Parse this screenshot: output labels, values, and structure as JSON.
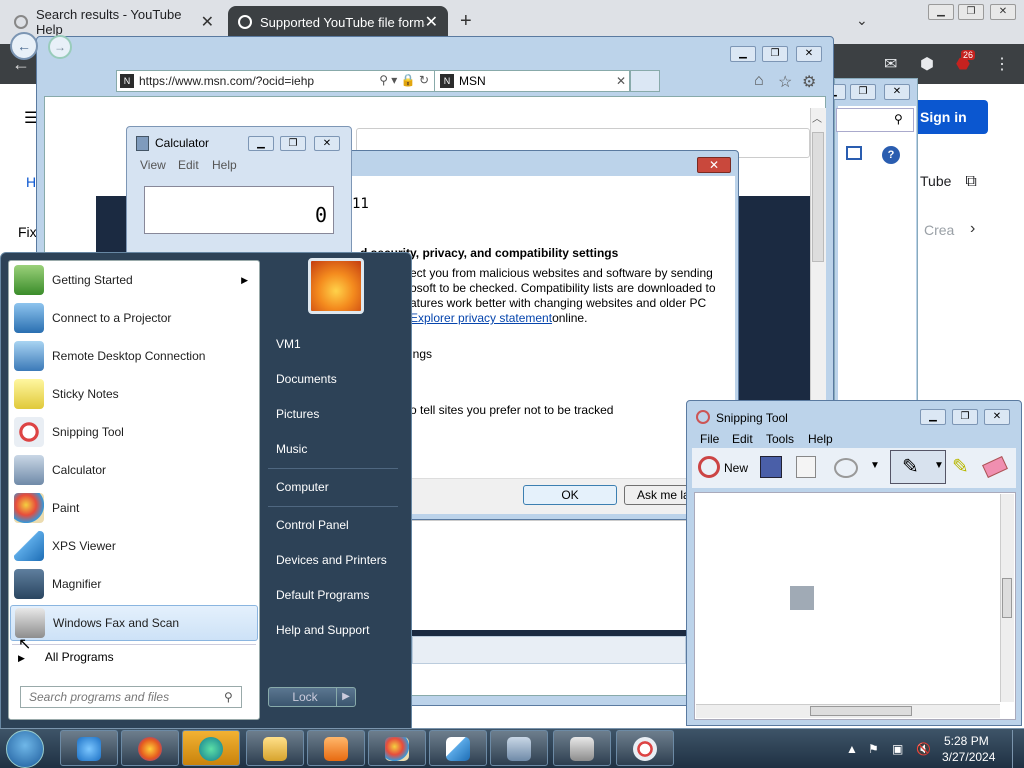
{
  "chrome": {
    "tabs": [
      {
        "title": "Search results - YouTube Help",
        "close": "✕"
      },
      {
        "title": "Supported YouTube file format",
        "close": "✕"
      }
    ],
    "new_tab": "+",
    "tab_menu": "⌄",
    "back": "←",
    "signin": "Sign in",
    "tube_text": "Tube",
    "crea_text": "Crea",
    "fix_text": "Fix",
    "h_text": "H",
    "ext_badge": "26",
    "toolbar_icons": [
      "✉",
      "⬢",
      "⋮"
    ]
  },
  "ie": {
    "address": "https://www.msn.com/?ocid=iehp",
    "address_icon": "N",
    "tab_title": "MSN",
    "tab_close": "✕"
  },
  "dialog": {
    "close": "✕",
    "version": "11",
    "heading": "d security, privacy, and compatibility settings",
    "line1": "ect you from malicious websites and software by sending",
    "line2": "osoft to be checked. Compatibility lists are downloaded to",
    "line3": "atures work better with changing websites and older PC",
    "link": "Explorer privacy statement",
    "link_suffix": " online.",
    "line_ings": "ings",
    "line_track": "o tell sites you prefer not to be tracked",
    "ok": "OK",
    "askme": "Ask me la"
  },
  "calculator": {
    "title": "Calculator",
    "menu": [
      "View",
      "Edit",
      "Help"
    ],
    "display": "0"
  },
  "start_menu": {
    "items": [
      {
        "label": "Getting Started",
        "arrow": "▶"
      },
      {
        "label": "Connect to a Projector"
      },
      {
        "label": "Remote Desktop Connection"
      },
      {
        "label": "Sticky Notes"
      },
      {
        "label": "Snipping Tool"
      },
      {
        "label": "Calculator"
      },
      {
        "label": "Paint"
      },
      {
        "label": "XPS Viewer"
      },
      {
        "label": "Magnifier"
      },
      {
        "label": "Windows Fax and Scan"
      }
    ],
    "all_programs": "All Programs",
    "search_placeholder": "Search programs and files",
    "right_items": [
      "VM1",
      "Documents",
      "Pictures",
      "Music",
      "Computer",
      "Control Panel",
      "Devices and Printers",
      "Default Programs",
      "Help and Support"
    ],
    "lock": "Lock"
  },
  "snipping_tool": {
    "title": "Snipping Tool",
    "menu": [
      "File",
      "Edit",
      "Tools",
      "Help"
    ],
    "new": "New"
  },
  "taskbar": {
    "time": "5:28 PM",
    "date": "3/27/2024"
  },
  "colors": {
    "aero_frame": "#bcd3ea",
    "start_menu_bg": "#2d4257",
    "chrome_toolbar": "#3c4043",
    "signin_blue": "#0b57d0",
    "close_red": "#c9483c"
  }
}
